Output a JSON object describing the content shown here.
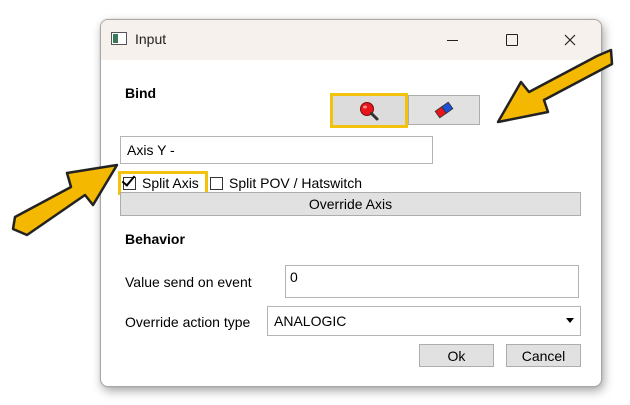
{
  "window": {
    "title": "Input"
  },
  "bind": {
    "section_label": "Bind",
    "input_value": "Axis Y -",
    "split_axis_label": "Split Axis",
    "split_axis_checked": true,
    "split_pov_label": "Split POV / Hatswitch",
    "split_pov_checked": false,
    "override_axis_label": "Override Axis"
  },
  "behavior": {
    "section_label": "Behavior",
    "value_label": "Value send on event",
    "value_input": "0",
    "override_type_label": "Override action type",
    "override_type_value": "ANALOGIC"
  },
  "buttons": {
    "ok": "Ok",
    "cancel": "Cancel"
  },
  "icons": {
    "search": "search-icon",
    "eraser": "eraser-icon",
    "app": "app-icon"
  },
  "colors": {
    "highlight": "#f2c20c",
    "arrow": "#f5b800",
    "titlebar": "#f6f1ec"
  }
}
